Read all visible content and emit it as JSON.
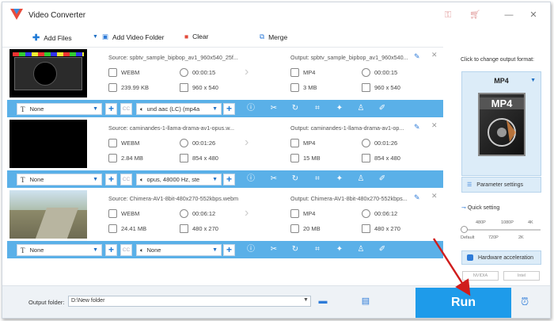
{
  "app": {
    "title": "Video Converter",
    "icons": [
      "key-icon",
      "cart-icon",
      "minimize-icon",
      "close-icon"
    ]
  },
  "toolbar": {
    "add_files": "Add Files",
    "add_folder": "Add Video Folder",
    "clear": "Clear",
    "merge": "Merge"
  },
  "items": [
    {
      "source": "Source: spbtv_sample_bipbop_av1_960x540_25f...",
      "output": "Output: spbtv_sample_bipbop_av1_960x540...",
      "src_format": "WEBM",
      "src_duration": "00:00:15",
      "src_size": "239.99 KB",
      "src_res": "960 x 540",
      "out_format": "MP4",
      "out_duration": "00:00:15",
      "out_size": "3 MB",
      "out_res": "960 x 540",
      "subtitle": "None",
      "audio": "und aac (LC) (mp4a"
    },
    {
      "source": "Source: caminandes-1-llama-drama-av1-opus.w...",
      "output": "Output: caminandes-1-llama-drama-av1-op...",
      "src_format": "WEBM",
      "src_duration": "00:01:26",
      "src_size": "2.84 MB",
      "src_res": "854 x 480",
      "out_format": "MP4",
      "out_duration": "00:01:26",
      "out_size": "15 MB",
      "out_res": "854 x 480",
      "subtitle": "None",
      "audio": "opus, 48000 Hz, ste"
    },
    {
      "source": "Source: Chimera-AV1-8bit-480x270-552kbps.webm",
      "output": "Output: Chimera-AV1-8bit-480x270-552kbps...",
      "src_format": "WEBM",
      "src_duration": "00:06:12",
      "src_size": "24.41 MB",
      "src_res": "480 x 270",
      "out_format": "MP4",
      "out_duration": "00:06:12",
      "out_size": "20 MB",
      "out_res": "480 x 270",
      "subtitle": "None",
      "audio": "None"
    }
  ],
  "right": {
    "click_label": "Click to change output format:",
    "format": "MP4",
    "param": "Parameter settings",
    "quick": "Quick setting",
    "ticks_top": [
      "480P",
      "1080P",
      "4K"
    ],
    "ticks_bottom": [
      "Default",
      "720P",
      "2K"
    ],
    "quick_level": 0,
    "hw": "Hardware acceleration",
    "vendors": [
      "NVIDIA",
      "Intel"
    ]
  },
  "bottom": {
    "output_label": "Output folder:",
    "output_value": "D:\\New folder",
    "run": "Run"
  },
  "colors": {
    "accent": "#1e9bea",
    "bar": "#5ab0e8",
    "run_arrow": "#d01d1d"
  }
}
